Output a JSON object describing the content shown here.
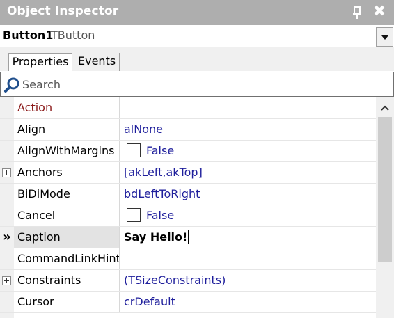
{
  "window": {
    "title": "Object Inspector",
    "pin_icon": "pin-icon",
    "close_glyph": "✖"
  },
  "selector": {
    "object_name": "Button1",
    "object_type": "TButton"
  },
  "tabs": [
    {
      "label": "Properties",
      "active": true
    },
    {
      "label": "Events",
      "active": false
    }
  ],
  "search": {
    "placeholder": "Search",
    "value": ""
  },
  "properties": [
    {
      "name": "Action",
      "value": "",
      "category": true
    },
    {
      "name": "Align",
      "value": "alNone"
    },
    {
      "name": "AlignWithMargins",
      "value": "False",
      "checkbox": true
    },
    {
      "name": "Anchors",
      "value": "[akLeft,akTop]",
      "expandable": true
    },
    {
      "name": "BiDiMode",
      "value": "bdLeftToRight"
    },
    {
      "name": "Cancel",
      "value": "False",
      "checkbox": true
    },
    {
      "name": "Caption",
      "value": "Say Hello!",
      "selected": true,
      "editing": true
    },
    {
      "name": "CommandLinkHint",
      "value": ""
    },
    {
      "name": "Constraints",
      "value": "(TSizeConstraints)",
      "expandable": true
    },
    {
      "name": "Cursor",
      "value": "crDefault"
    }
  ],
  "current_marker": "»",
  "colors": {
    "titlebar": "#aeaeae",
    "category_name": "#8b1a1a",
    "value_text": "#1f1f9c"
  }
}
